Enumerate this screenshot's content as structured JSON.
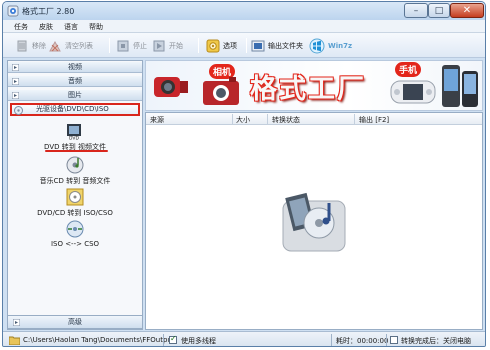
{
  "window": {
    "title": "格式工厂 2.80"
  },
  "menu": [
    "任务",
    "皮肤",
    "语言",
    "帮助"
  ],
  "toolbar": {
    "remove": "移除",
    "clear_list": "清空列表",
    "stop": "停止",
    "start": "开始",
    "options": "选项",
    "output_folder": "输出文件夹",
    "win7": "Win7z"
  },
  "sidebar": {
    "categories": [
      "视频",
      "音频",
      "图片"
    ],
    "active_category": "光驱设备\\DVD\\CD\\ISO",
    "functions": [
      "DVD 转到 视频文件",
      "音乐CD 转到 音频文件",
      "DVD/CD 转到 ISO/CSO",
      "ISO <--> CSO"
    ],
    "advanced": "高级"
  },
  "banner": {
    "title": "格式工厂",
    "camera_label": "相机",
    "phone_label": "手机"
  },
  "table": {
    "columns": [
      "来源",
      "大小",
      "转换状态",
      "输出 [F2]"
    ]
  },
  "status": {
    "output_path": "C:\\Users\\Haolan Tang\\Documents\\FFOutput",
    "multithread_label": "使用多线程",
    "elapsed": "耗时：00:00:00",
    "after_complete": "转换完成后：关闭电脑"
  }
}
